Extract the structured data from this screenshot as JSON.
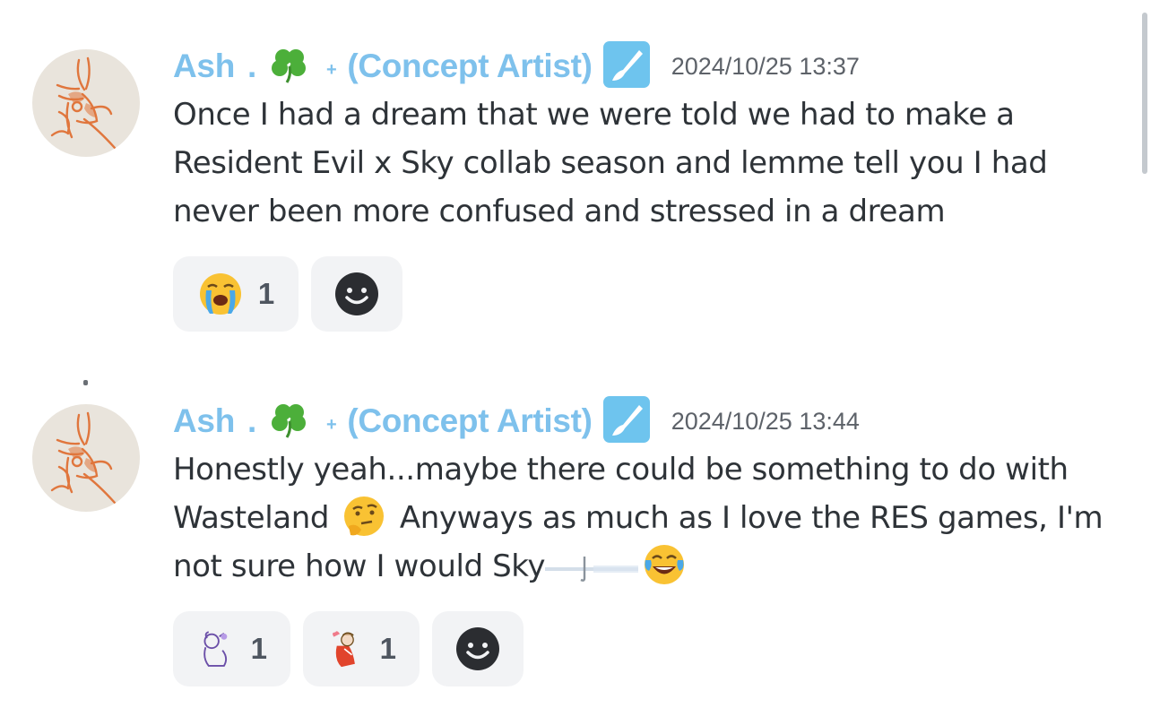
{
  "messages": [
    {
      "author": {
        "name": "Ash",
        "dot": ".",
        "plus": "+",
        "role": "(Concept Artist)"
      },
      "timestamp": "2024/10/25 13:37",
      "text": "Once I had a dream that we were told we had to make a Resident Evil x Sky collab season and lemme tell you I had never been more confused and stressed in a dream",
      "reactions": [
        {
          "emoji": "loudly-crying-face-icon",
          "count": "1"
        }
      ]
    },
    {
      "author": {
        "name": "Ash",
        "dot": ".",
        "plus": "+",
        "role": "(Concept Artist)"
      },
      "timestamp": "2024/10/25 13:44",
      "text_part1": "Honestly yeah...maybe there could be something to do with Wasteland",
      "text_part2": " Anyways as much as I love the RES games, I'm not sure how I would Sky",
      "reactions": [
        {
          "emoji": "custom-sticker-purple-icon",
          "count": "1"
        },
        {
          "emoji": "custom-sticker-red-cape-icon",
          "count": "1"
        }
      ]
    }
  ],
  "colors": {
    "author": "#7ec1ec",
    "role_icon_bg": "#6ec4ee",
    "reaction_bg": "#f2f3f5",
    "text": "#2e3338",
    "timestamp": "#5d6269"
  }
}
